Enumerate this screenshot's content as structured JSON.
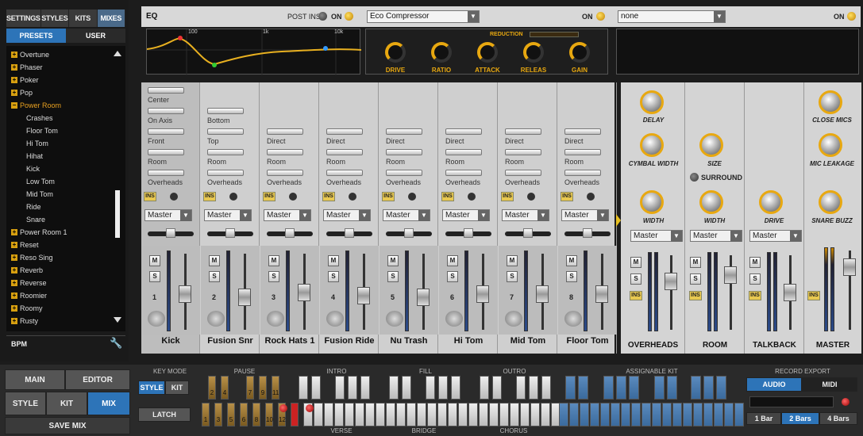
{
  "tabs": {
    "settings": "SETTINGS",
    "styles": "STYLES",
    "kits": "KITS",
    "mixes": "MIXES"
  },
  "subtabs": {
    "presets": "PRESETS",
    "user": "USER"
  },
  "presets": [
    {
      "label": "Overtune",
      "type": "folder"
    },
    {
      "label": "Phaser",
      "type": "folder"
    },
    {
      "label": "Poker",
      "type": "folder"
    },
    {
      "label": "Pop",
      "type": "folder"
    },
    {
      "label": "Power Room",
      "type": "open"
    },
    {
      "label": "Crashes",
      "type": "child"
    },
    {
      "label": "Floor Tom",
      "type": "child"
    },
    {
      "label": "Hi Tom",
      "type": "child"
    },
    {
      "label": "Hihat",
      "type": "child"
    },
    {
      "label": "Kick",
      "type": "child"
    },
    {
      "label": "Low Tom",
      "type": "child"
    },
    {
      "label": "Mid Tom",
      "type": "child"
    },
    {
      "label": "Ride",
      "type": "child"
    },
    {
      "label": "Snare",
      "type": "child"
    },
    {
      "label": "Power Room 1",
      "type": "folder"
    },
    {
      "label": "Reset",
      "type": "folder"
    },
    {
      "label": "Reso Sing",
      "type": "folder"
    },
    {
      "label": "Reverb",
      "type": "folder"
    },
    {
      "label": "Reverse",
      "type": "folder"
    },
    {
      "label": "Roomier",
      "type": "folder"
    },
    {
      "label": "Roomy",
      "type": "folder"
    },
    {
      "label": "Rusty",
      "type": "folder"
    }
  ],
  "bpm": "BPM",
  "eq": {
    "title": "EQ",
    "postins": "POST INS",
    "on": "ON",
    "ticks": [
      "100",
      "1k",
      "10k"
    ]
  },
  "insert1": {
    "value": "Eco Compressor",
    "on": "ON",
    "reduction": "REDUCTION",
    "knobs": [
      "DRIVE",
      "RATIO",
      "ATTACK",
      "RELEAS",
      "GAIN"
    ]
  },
  "insert2": {
    "value": "none",
    "on": "ON"
  },
  "strips": [
    {
      "name": "Kick",
      "num": "1",
      "sends": [
        "Center",
        "On Axis",
        "Front",
        "Room",
        "Overheads"
      ],
      "bus": "Master",
      "m": "M",
      "s": "S",
      "ins": "INS"
    },
    {
      "name": "Fusion Snr",
      "num": "2",
      "sends": [
        "Bottom",
        "Top",
        "Room",
        "Overheads"
      ],
      "bus": "Master",
      "m": "M",
      "s": "S",
      "ins": "INS"
    },
    {
      "name": "Rock Hats 1",
      "num": "3",
      "sends": [
        "Direct",
        "Room",
        "Overheads"
      ],
      "bus": "Master",
      "m": "M",
      "s": "S",
      "ins": "INS"
    },
    {
      "name": "Fusion Ride",
      "num": "4",
      "sends": [
        "Direct",
        "Room",
        "Overheads"
      ],
      "bus": "Master",
      "m": "M",
      "s": "S",
      "ins": "INS"
    },
    {
      "name": "Nu Trash",
      "num": "5",
      "sends": [
        "Direct",
        "Room",
        "Overheads"
      ],
      "bus": "Master",
      "m": "M",
      "s": "S",
      "ins": "INS"
    },
    {
      "name": "Hi Tom",
      "num": "6",
      "sends": [
        "Direct",
        "Room",
        "Overheads"
      ],
      "bus": "Master",
      "m": "M",
      "s": "S",
      "ins": "INS"
    },
    {
      "name": "Mid Tom",
      "num": "7",
      "sends": [
        "Direct",
        "Room",
        "Overheads"
      ],
      "bus": "Master",
      "m": "M",
      "s": "S",
      "ins": "INS"
    },
    {
      "name": "Floor Tom",
      "num": "8",
      "sends": [
        "Direct",
        "Room",
        "Overheads"
      ],
      "bus": "Master",
      "m": "M",
      "s": "S",
      "ins": "INS"
    }
  ],
  "fx": {
    "overheads": {
      "name": "OVERHEADS",
      "knobs": [
        "DELAY",
        "CYMBAL WIDTH",
        "WIDTH"
      ],
      "bus": "Master"
    },
    "room": {
      "name": "ROOM",
      "knobs": [
        "SIZE",
        "WIDTH"
      ],
      "surround": "SURROUND",
      "bus": "Master"
    },
    "talkback": {
      "name": "TALKBACK",
      "knobs": [
        "DRIVE"
      ],
      "bus": "Master"
    },
    "master": {
      "name": "MASTER",
      "knobs": [
        "CLOSE MICS",
        "MIC LEAKAGE",
        "SNARE BUZZ"
      ]
    }
  },
  "bottom": {
    "main": "MAIN",
    "editor": "EDITOR",
    "style": "STYLE",
    "kit": "KIT",
    "mix": "MIX",
    "savemix": "SAVE MIX",
    "keymode": "KEY MODE",
    "km_style": "STYLE",
    "km_kit": "KIT",
    "latch": "LATCH",
    "pause": "PAUSE",
    "intro": "INTRO",
    "fill": "FILL",
    "outro": "OUTRO",
    "assignable": "ASSIGNABLE KIT",
    "verse": "VERSE",
    "bridge": "BRIDGE",
    "chorus": "CHORUS",
    "record": "RECORD EXPORT",
    "audio": "AUDIO",
    "midi": "MIDI",
    "bar1": "1 Bar",
    "bar2": "2 Bars",
    "bar4": "4 Bars",
    "pause_top": [
      "2",
      "4",
      "7",
      "9",
      "11"
    ],
    "pause_bot": [
      "1",
      "3",
      "5",
      "6",
      "8",
      "10",
      "12"
    ]
  }
}
